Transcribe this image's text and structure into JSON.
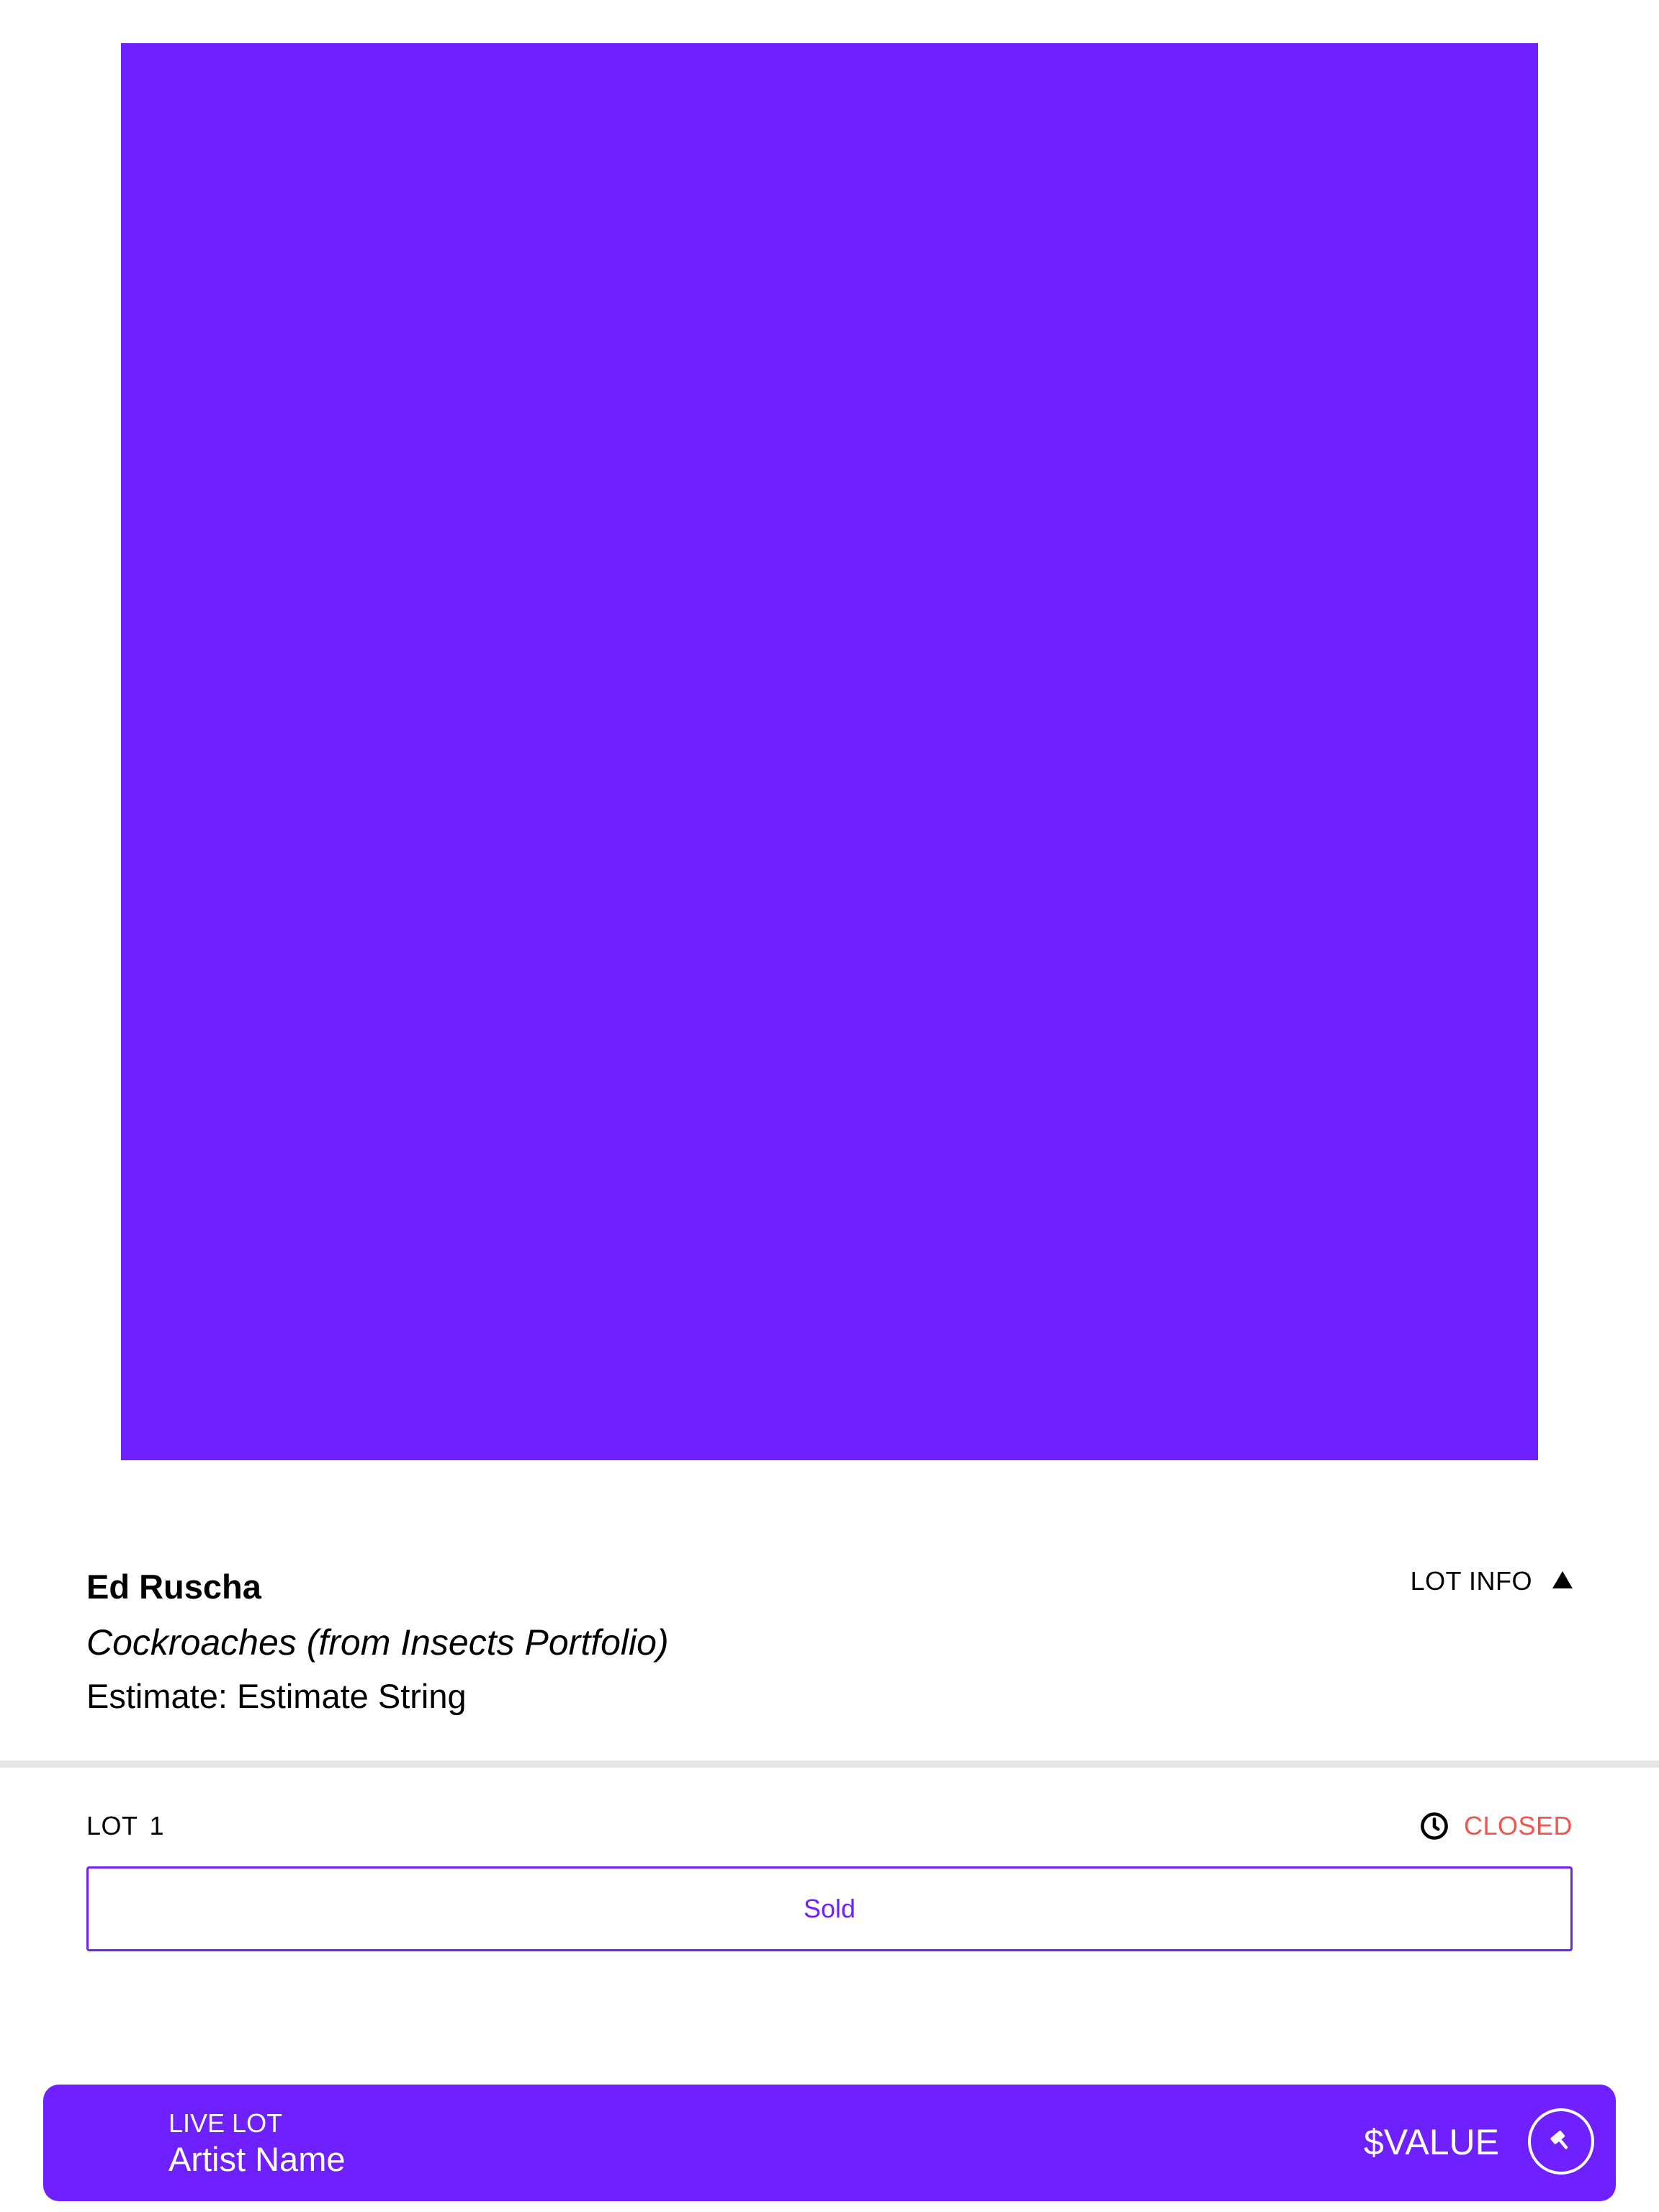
{
  "colors": {
    "accent": "#6e20ff",
    "closed": "#f2544e",
    "divider": "#e6e6e6"
  },
  "lot": {
    "artist": "Ed Ruscha",
    "title": "Cockroaches (from Insects Portfolio)",
    "estimate": "Estimate: Estimate String",
    "info_toggle_label": "LOT INFO",
    "info_toggle_icon": "triangle-up-icon",
    "number_label": "LOT",
    "number_value": "1",
    "status_icon": "clock-icon",
    "status_label": "CLOSED",
    "action_label": "Sold"
  },
  "live_lot_bar": {
    "label": "LIVE LOT",
    "artist": "Artist Name",
    "value": "$VALUE",
    "icon": "gavel-icon"
  }
}
